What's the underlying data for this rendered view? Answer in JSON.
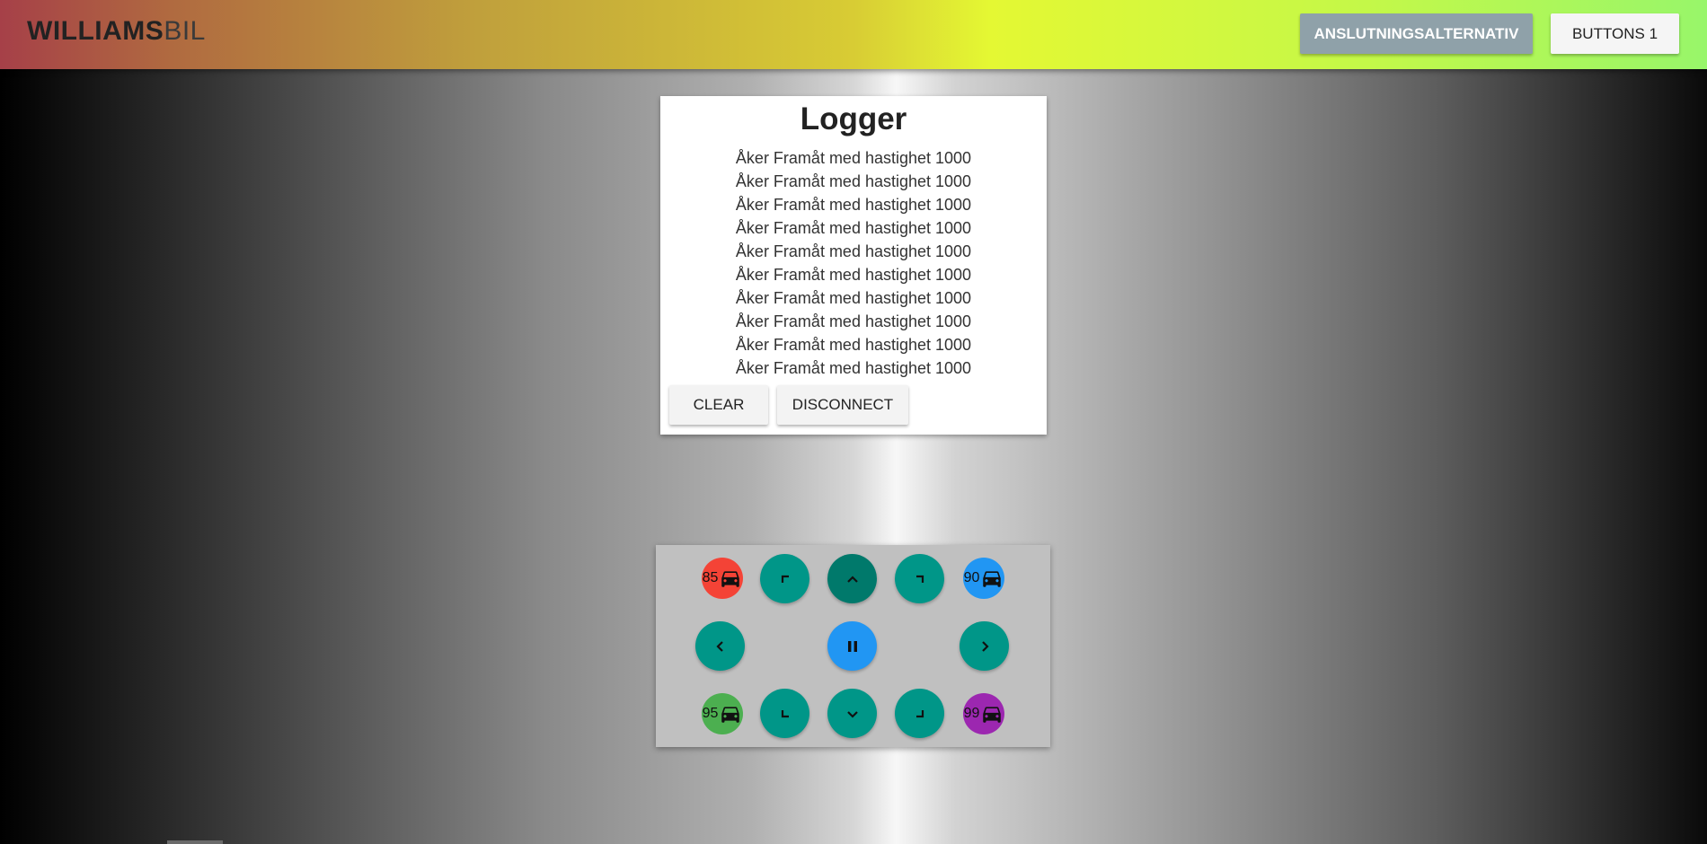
{
  "header": {
    "brand_bold": "WILLIAMS",
    "brand_light": "BIL",
    "connection_button": "ANSLUTNINGSALTERNATIV",
    "buttons_button": "BUTTONS 1"
  },
  "logger": {
    "title": "Logger",
    "entries": [
      "Åker Framåt med hastighet 1000",
      "Åker Framåt med hastighet 1000",
      "Åker Framåt med hastighet 1000",
      "Åker Framåt med hastighet 1000",
      "Åker Framåt med hastighet 1000",
      "Åker Framåt med hastighet 1000",
      "Åker Framåt med hastighet 1000",
      "Åker Framåt med hastighet 1000",
      "Åker Framåt med hastighet 1000",
      "Åker Framåt med hastighet 1000"
    ],
    "clear_label": "CLEAR",
    "disconnect_label": "DISCONNECT"
  },
  "controls": {
    "speeds": [
      {
        "value": "85",
        "color": "#f44336"
      },
      {
        "value": "90",
        "color": "#2196f3"
      },
      {
        "value": "95",
        "color": "#4caf50"
      },
      {
        "value": "99",
        "color": "#9c27b0"
      }
    ],
    "icons": {
      "forward_left": "corner-top-left-icon",
      "forward": "chevron-up-icon",
      "forward_right": "corner-top-right-icon",
      "left": "chevron-left-icon",
      "pause": "pause-icon",
      "right": "chevron-right-icon",
      "backward_left": "corner-bottom-left-icon",
      "backward": "chevron-down-icon",
      "backward_right": "corner-bottom-right-icon",
      "speed": "car-icon"
    },
    "colors": {
      "button": "#009688",
      "button_active": "#00796b",
      "pause": "#2196f3"
    }
  }
}
